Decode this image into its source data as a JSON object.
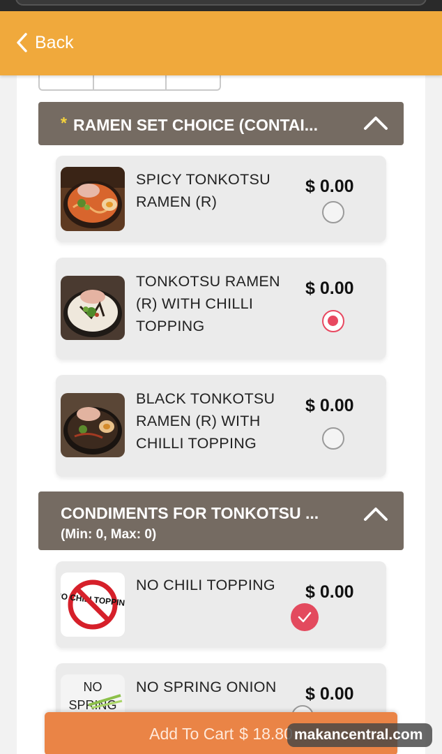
{
  "header": {
    "back_label": "Back",
    "color": "#f0a93c"
  },
  "sections": [
    {
      "required_marker": "*",
      "title": "RAMEN SET CHOICE (CONTAI...",
      "items": [
        {
          "name": "SPICY TONKOTSU RAMEN (R)",
          "price": "$ 0.00",
          "selected": false,
          "image_icon": "spicy-ramen-bowl"
        },
        {
          "name": "TONKOTSU RAMEN (R) WITH CHILLI TOPPING",
          "price": "$ 0.00",
          "selected": true,
          "image_icon": "white-broth-ramen-bowl"
        },
        {
          "name": "BLACK TONKOTSU RAMEN (R) WITH CHILLI TOPPING",
          "price": "$ 0.00",
          "selected": false,
          "image_icon": "black-ramen-bowl"
        }
      ]
    },
    {
      "title": "CONDIMENTS FOR TONKOTSU ...",
      "subtitle": "(Min: 0, Max: 0)",
      "items": [
        {
          "name": "NO CHILI TOPPING",
          "price": "$ 0.00",
          "checked": true,
          "image_text": "NO CHILI TOPPING"
        },
        {
          "name": "NO SPRING ONION",
          "price": "$ 0.00",
          "checked": false,
          "image_text_line1": "NO",
          "image_text_line2": "SPRING"
        }
      ]
    }
  ],
  "cart": {
    "label": "Add To Cart",
    "total": "$ 18.80"
  },
  "watermark": "makancentral.com",
  "colors": {
    "section_bg": "#756b62",
    "accent": "#e84860",
    "cart": "#ea8446"
  }
}
